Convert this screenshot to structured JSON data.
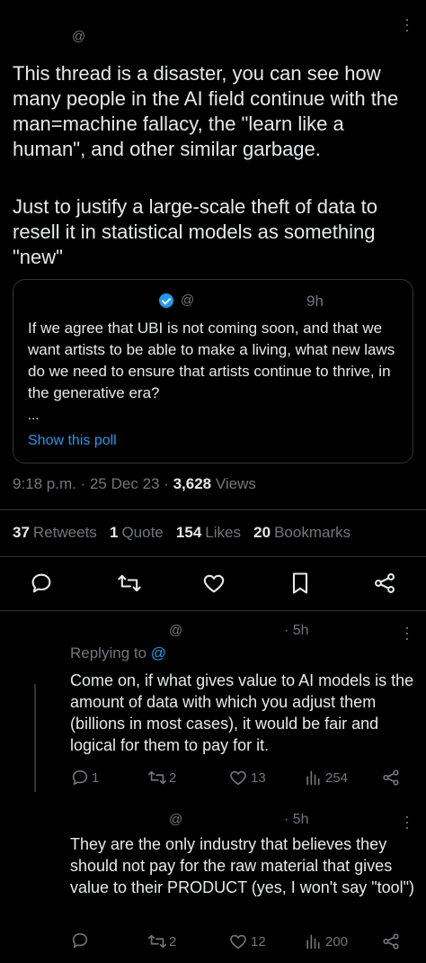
{
  "main_tweet": {
    "handle": "@",
    "text_p1": "This thread is a disaster, you can see how many people in the AI field continue with the man=machine fallacy, the \"learn like a human\", and other similar garbage.",
    "text_p2": "Just to justify a large-scale theft of data to resell it in statistical models as something \"new\"",
    "quote": {
      "handle": "@",
      "time": "9h",
      "text": "If we agree that UBI is not coming soon, and that we want artists to be able to make a living, what new laws do we need to ensure that artists continue to thrive, in the generative era?",
      "ellipsis": "...",
      "poll_link": "Show this poll"
    },
    "timestamp": "9:18 p.m. · 25 Dec 23 · ",
    "views_count": "3,628",
    "views_label": " Views",
    "stats": {
      "retweets_count": "37",
      "retweets_label": "Retweets",
      "quote_count": "1",
      "quote_label": "Quote",
      "likes_count": "154",
      "likes_label": "Likes",
      "bookmarks_count": "20",
      "bookmarks_label": "Bookmarks"
    }
  },
  "replies": [
    {
      "handle": "@",
      "time": "· 5h",
      "replying_to_label": "Replying to",
      "replying_to_handle": "@",
      "text": "Come on, if what gives value to AI models is the amount of data with which you adjust them (billions in most cases), it would be fair and logical for them to pay for it.",
      "reply_count": "1",
      "retweet_count": "2",
      "like_count": "13",
      "view_count": "254"
    },
    {
      "handle": "@",
      "time": "· 5h",
      "text": "They are the only industry that believes they should not pay for the raw material that gives value to their PRODUCT (yes, I won't say \"tool\")",
      "retweet_count": "2",
      "like_count": "12",
      "view_count": "200"
    }
  ],
  "icons": [
    "more-icon",
    "verified-icon",
    "reply-icon",
    "retweet-icon",
    "like-icon",
    "bookmark-icon",
    "share-icon",
    "views-icon"
  ],
  "colors": {
    "background": "#000000",
    "text": "#e7e9ea",
    "muted": "#71767b",
    "link": "#1d9bf0",
    "border": "#2f3336"
  }
}
